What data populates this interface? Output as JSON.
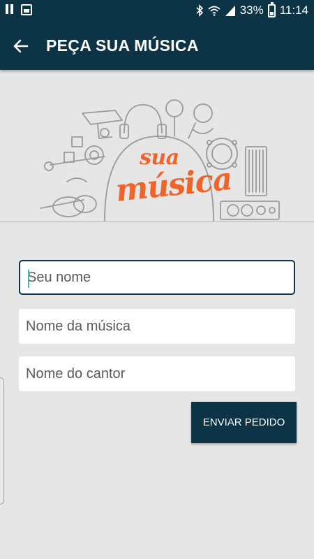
{
  "status_bar": {
    "battery": "33%",
    "time": "11:14",
    "icons": [
      "pause-icon",
      "gallery-icon",
      "bluetooth-icon",
      "wifi-icon",
      "signal-icon",
      "battery-icon"
    ]
  },
  "app_bar": {
    "title": "PEÇA SUA MÚSICA",
    "back_icon": "arrow-back-icon"
  },
  "logo": {
    "line1": "sua",
    "line2": "música",
    "color": "#f0642a"
  },
  "form": {
    "name": {
      "placeholder": "Seu nome",
      "value": ""
    },
    "song": {
      "placeholder": "Nome da música",
      "value": ""
    },
    "singer": {
      "placeholder": "Nome do cantor",
      "value": ""
    },
    "submit_label": "ENVIAR PEDIDO"
  },
  "colors": {
    "primary": "#0d3446",
    "background": "#e6e6e6",
    "accent": "#f0642a"
  }
}
